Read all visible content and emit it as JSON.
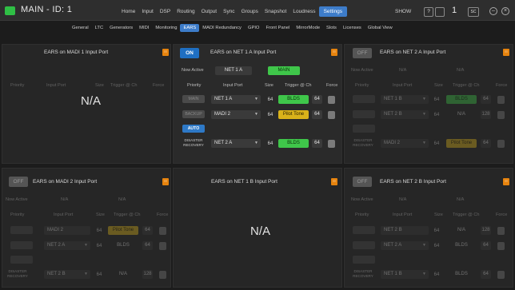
{
  "app": {
    "title": "MAIN - ID: 1",
    "show_label": "SHOW",
    "box1_label": "?",
    "number": "1",
    "box2_label": "SC"
  },
  "main_nav": [
    "Home",
    "Input",
    "DSP",
    "Routing",
    "Output",
    "Sync",
    "Groups",
    "Snapshot",
    "Loudness",
    "Settings"
  ],
  "main_nav_active": "Settings",
  "sub_nav": [
    "General",
    "LTC",
    "Generators",
    "MIDI",
    "Monitoring",
    "EARS",
    "MADI Redundancy",
    "GPIO",
    "Front Panel",
    "MirrorMode",
    "Slots",
    "Licenses",
    "Global View"
  ],
  "sub_nav_active": "EARS",
  "colors": {
    "accent": "#3d7cc9",
    "on": "#1f6fc2",
    "green": "#3fc64a",
    "yellow": "#d9b21a",
    "warn": "#e6830d"
  },
  "icons": [
    "warning-icon",
    "chevron-down-icon",
    "help-icon",
    "close-icon"
  ],
  "columns": {
    "priority": "Priority",
    "input_port": "Input Port",
    "size": "Size",
    "trigger": "Trigger",
    "at": "@",
    "ch": "Ch",
    "force": "Force"
  },
  "panels": {
    "madi1": {
      "title": "EARS on MADI 1 Input Port",
      "na": "N/A"
    },
    "net1a": {
      "toggle": "ON",
      "title": "EARS on NET 1 A Input Port",
      "now_active_label": "Now Active",
      "now_active_value": "NET 1 A",
      "now_active_tag": "MAIN",
      "rows": [
        {
          "priority": "MAIN",
          "port": "NET 1 A",
          "size": "64",
          "trigger": "BLDS",
          "trigger_color": "green",
          "ch": "64"
        },
        {
          "priority": "BACKUP",
          "port": "MADI 2",
          "size": "64",
          "trigger": "Pilot Tone",
          "trigger_color": "yellow",
          "ch": "64"
        }
      ],
      "auto_label": "AUTO",
      "disaster": {
        "label": "DISASTER RECOVERY",
        "port": "NET 2 A",
        "size": "64",
        "trigger": "BLDS",
        "ch": "64"
      }
    },
    "net2a": {
      "toggle": "OFF",
      "title": "EARS on NET 2 A Input Port",
      "now_active_label": "Now Active",
      "now_active_value": "N/A",
      "now_active_tag": "N/A",
      "rows": [
        {
          "port": "NET 1 B",
          "size": "64",
          "trigger": "BLDS",
          "trigger_color": "green",
          "ch": "64"
        },
        {
          "port": "NET 2 B",
          "size": "64",
          "trigger": "N/A",
          "trigger_color": "none",
          "ch": "128"
        }
      ],
      "disaster": {
        "label": "DISASTER RECOVERY",
        "port": "MADI 2",
        "size": "64",
        "trigger": "Pilot Tone",
        "ch": "64"
      }
    },
    "madi2": {
      "toggle": "OFF",
      "title": "EARS on MADI 2 Input Port",
      "now_active_label": "Now Active",
      "now_active_value": "N/A",
      "now_active_tag": "N/A",
      "rows": [
        {
          "port": "MADI 2",
          "size": "64",
          "trigger": "Pilot Tone",
          "trigger_color": "yellow",
          "ch": "64"
        },
        {
          "port": "NET 2 A",
          "size": "64",
          "trigger": "BLDS",
          "trigger_color": "none",
          "ch": "64"
        }
      ],
      "disaster": {
        "label": "DISASTER RECOVERY",
        "port": "NET 2 B",
        "size": "64",
        "trigger": "N/A",
        "ch": "128"
      }
    },
    "net1b": {
      "title": "EARS on NET 1 B Input Port",
      "na": "N/A"
    },
    "net2b": {
      "toggle": "OFF",
      "title": "EARS on NET 2 B Input Port",
      "now_active_label": "Now Active",
      "now_active_value": "N/A",
      "now_active_tag": "N/A",
      "rows": [
        {
          "port": "NET 2 B",
          "size": "64",
          "trigger": "N/A",
          "trigger_color": "none",
          "ch": "128"
        },
        {
          "port": "NET 2 A",
          "size": "64",
          "trigger": "BLDS",
          "trigger_color": "none",
          "ch": "64"
        }
      ],
      "disaster": {
        "label": "DISASTER RECOVERY",
        "port": "NET 1 B",
        "size": "64",
        "trigger": "BLDS",
        "ch": "64"
      }
    }
  }
}
